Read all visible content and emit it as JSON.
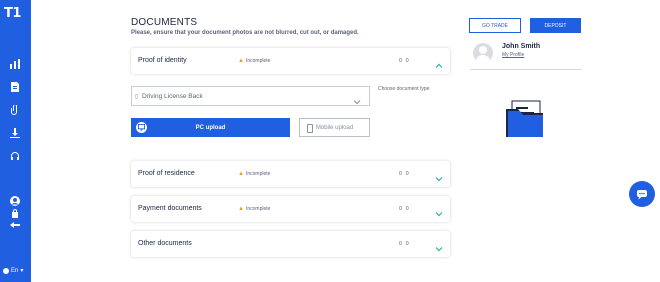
{
  "brand": {
    "logo_text": "T1",
    "accent": "#1f5fe0"
  },
  "sidebar": {
    "items": [
      {
        "icon": "chart-icon"
      },
      {
        "icon": "document-icon"
      },
      {
        "icon": "attachment-icon"
      },
      {
        "icon": "download-icon"
      },
      {
        "icon": "headphones-icon"
      }
    ],
    "bottom_items": [
      {
        "icon": "user-icon"
      },
      {
        "icon": "lock-icon"
      },
      {
        "icon": "logout-icon"
      }
    ],
    "language": "En"
  },
  "header": {
    "title": "DOCUMENTS",
    "subtitle": "Please, ensure that your document photos are not blurred, cut out, or damaged.",
    "go_trade_label": "GO TRADE",
    "deposit_label": "DEPOSIT"
  },
  "profile": {
    "name": "John Smith",
    "link": "My Profile"
  },
  "documents": [
    {
      "title": "Proof of identity",
      "status": "Incomplete",
      "count": "0 0",
      "expanded": true
    },
    {
      "title": "Proof of residence",
      "status": "Incomplete",
      "count": "0 0",
      "expanded": false
    },
    {
      "title": "Payment documents",
      "status": "Incomplete",
      "count": "0 0",
      "expanded": false
    },
    {
      "title": "Other documents",
      "status": "",
      "count": "0 0",
      "expanded": false
    }
  ],
  "upload": {
    "document_type_value": "Driving License Back",
    "document_type_label": "Choose document type",
    "pc_upload_label": "PC upload",
    "mobile_upload_label": "Mobile upload"
  },
  "colors": {
    "warning": "#e6a21b",
    "chevron": "#2bb3a3"
  }
}
